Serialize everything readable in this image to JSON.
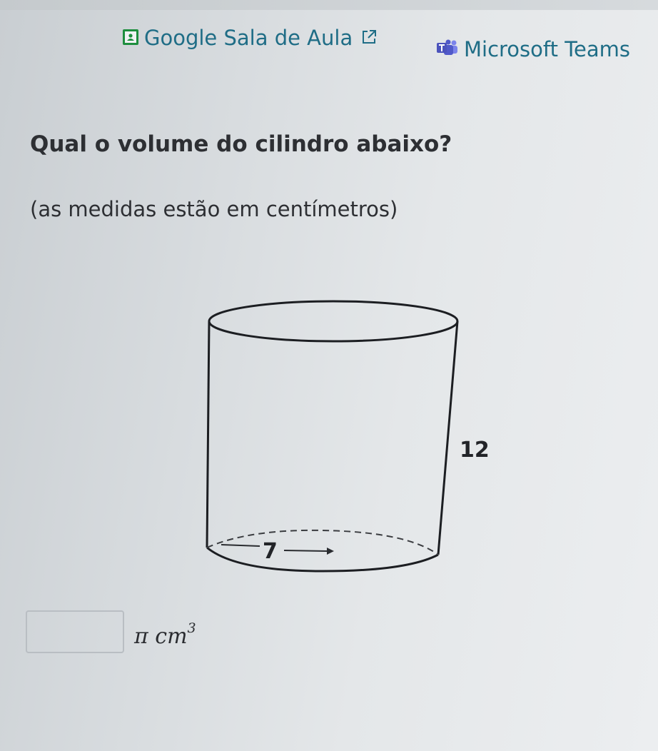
{
  "header": {
    "links": [
      {
        "label": "Google Sala de Aula",
        "icon": "google-classroom-icon",
        "has_external_icon": true
      },
      {
        "label": "Microsoft Teams",
        "icon": "microsoft-teams-icon"
      }
    ]
  },
  "question": {
    "prompt": "Qual o volume do cilindro abaixo?",
    "note": "(as medidas estão em centímetros)"
  },
  "figure": {
    "shape": "cylinder",
    "height_label": "12",
    "radius_label": "7"
  },
  "answer": {
    "value": "",
    "placeholder": "",
    "unit_pi": "π",
    "unit_text": "cm",
    "unit_exponent": "3"
  },
  "colors": {
    "link": "#1f6d86",
    "text": "#2d2f33",
    "classroom_icon": "#1e8e3e",
    "teams_icon": "#5059c9"
  }
}
